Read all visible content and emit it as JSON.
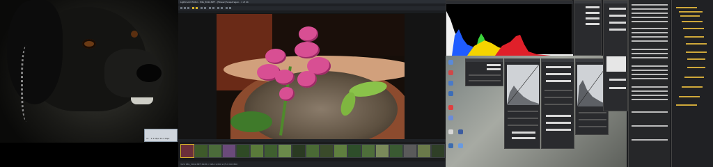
{
  "left_monitor": {
    "dialog_text": "x1 : 1.1 Mpx  12.4 Mpx"
  },
  "viewer": {
    "title": "Lightroom Editor - IMG_3042.NEF - [Flower] Snapdragon - 1 of 24",
    "status": "3/24   IMG_3042.NEF   4928 x 3264   1/200 s   f/5.6   ISO 800"
  },
  "colors": {
    "accent": "#d4b02b",
    "flower": "#d84f93",
    "histogram_blue": "#1f5cff",
    "histogram_yellow": "#f5d400",
    "histogram_red": "#e0202a",
    "histogram_green": "#3bd43b"
  },
  "histogram": {
    "channels": [
      "luminance",
      "blue",
      "yellow",
      "red",
      "green"
    ]
  },
  "desktop_icons": [
    {
      "name": "recycle-bin-icon"
    },
    {
      "name": "computer-icon"
    },
    {
      "name": "network-icon"
    },
    {
      "name": "browser-icon"
    },
    {
      "name": "mail-icon"
    },
    {
      "name": "folder-icon"
    },
    {
      "name": "photo-app-icon"
    },
    {
      "name": "settings-icon"
    }
  ],
  "thumbs": [
    {
      "color": "#6b2f3a"
    },
    {
      "color": "#3e5a2a"
    },
    {
      "color": "#4b6b3a"
    },
    {
      "color": "#6a4a7a"
    },
    {
      "color": "#2f4a25"
    },
    {
      "color": "#5a7a3a"
    },
    {
      "color": "#3f5f2f"
    },
    {
      "color": "#6a8a4a"
    },
    {
      "color": "#2a3a22"
    },
    {
      "color": "#4a6a35"
    },
    {
      "color": "#3a4a2a"
    },
    {
      "color": "#5f7f3f"
    },
    {
      "color": "#2e4e2a"
    },
    {
      "color": "#4e6e3a"
    },
    {
      "color": "#7a8a5a"
    },
    {
      "color": "#3a5a32"
    },
    {
      "color": "#5a5a5a"
    },
    {
      "color": "#6a7a4a"
    },
    {
      "color": "#2f3f27"
    }
  ]
}
